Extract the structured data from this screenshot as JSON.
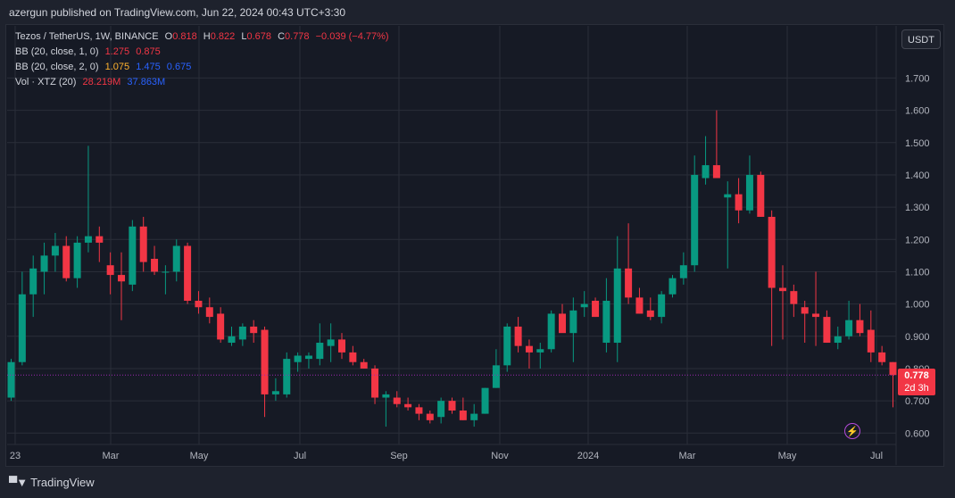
{
  "header": {
    "publisher_line": "azergun published on TradingView.com, Jun 22, 2024 00:43 UTC+3:30"
  },
  "legend": {
    "symbol": "Tezos / TetherUS, 1W, BINANCE",
    "o_label": "O",
    "o": "0.818",
    "h_label": "H",
    "h": "0.822",
    "l_label": "L",
    "l": "0.678",
    "c_label": "C",
    "c": "0.778",
    "change": "−0.039 (−4.77%)",
    "bb1_label": "BB (20, close, 1, 0)",
    "bb1_v1": "1.275",
    "bb1_v2": "0.875",
    "bb2_label": "BB (20, close, 2, 0)",
    "bb2_v1": "1.075",
    "bb2_v2": "1.475",
    "bb2_v3": "0.675",
    "vol_label": "Vol · XTZ (20)",
    "vol_v1": "28.219M",
    "vol_v2": "37.863M"
  },
  "unit_button": "USDT",
  "last_price": {
    "value": "0.778",
    "countdown": "2d 3h"
  },
  "footer": {
    "brand": "TradingView"
  },
  "colors": {
    "up": "#089981",
    "down": "#f23645",
    "background": "#161a25",
    "grid": "#2a2e39",
    "last_price_line": "#9c27b0"
  },
  "chart_data": {
    "type": "candlestick",
    "y_ticks": [
      "0.600",
      "0.700",
      "0.800",
      "0.900",
      "1.000",
      "1.100",
      "1.200",
      "1.300",
      "1.400",
      "1.500",
      "1.600",
      "1.700"
    ],
    "x_ticks": [
      "23",
      "Mar",
      "May",
      "Jul",
      "Sep",
      "Nov",
      "2024",
      "Mar",
      "May",
      "Jul"
    ],
    "ylim": [
      0.56,
      1.81
    ],
    "candles": [
      {
        "o": 0.71,
        "h": 0.83,
        "l": 0.7,
        "c": 0.82
      },
      {
        "o": 0.82,
        "h": 1.1,
        "l": 0.81,
        "c": 1.03
      },
      {
        "o": 1.03,
        "h": 1.15,
        "l": 0.96,
        "c": 1.11
      },
      {
        "o": 1.1,
        "h": 1.19,
        "l": 1.03,
        "c": 1.15
      },
      {
        "o": 1.15,
        "h": 1.22,
        "l": 1.1,
        "c": 1.18
      },
      {
        "o": 1.18,
        "h": 1.21,
        "l": 1.07,
        "c": 1.08
      },
      {
        "o": 1.08,
        "h": 1.21,
        "l": 1.05,
        "c": 1.19
      },
      {
        "o": 1.19,
        "h": 1.49,
        "l": 1.16,
        "c": 1.21
      },
      {
        "o": 1.21,
        "h": 1.24,
        "l": 1.13,
        "c": 1.19
      },
      {
        "o": 1.12,
        "h": 1.16,
        "l": 1.03,
        "c": 1.09
      },
      {
        "o": 1.09,
        "h": 1.16,
        "l": 0.95,
        "c": 1.07
      },
      {
        "o": 1.06,
        "h": 1.26,
        "l": 1.04,
        "c": 1.24
      },
      {
        "o": 1.24,
        "h": 1.27,
        "l": 1.1,
        "c": 1.13
      },
      {
        "o": 1.14,
        "h": 1.18,
        "l": 1.09,
        "c": 1.1
      },
      {
        "o": 1.1,
        "h": 1.12,
        "l": 1.03,
        "c": 1.1
      },
      {
        "o": 1.1,
        "h": 1.2,
        "l": 1.07,
        "c": 1.18
      },
      {
        "o": 1.18,
        "h": 1.19,
        "l": 1.0,
        "c": 1.01
      },
      {
        "o": 1.01,
        "h": 1.04,
        "l": 0.97,
        "c": 0.99
      },
      {
        "o": 0.99,
        "h": 1.02,
        "l": 0.94,
        "c": 0.96
      },
      {
        "o": 0.97,
        "h": 0.99,
        "l": 0.88,
        "c": 0.89
      },
      {
        "o": 0.88,
        "h": 0.93,
        "l": 0.87,
        "c": 0.9
      },
      {
        "o": 0.89,
        "h": 0.94,
        "l": 0.87,
        "c": 0.93
      },
      {
        "o": 0.93,
        "h": 0.95,
        "l": 0.88,
        "c": 0.91
      },
      {
        "o": 0.92,
        "h": 0.93,
        "l": 0.65,
        "c": 0.72
      },
      {
        "o": 0.72,
        "h": 0.77,
        "l": 0.7,
        "c": 0.73
      },
      {
        "o": 0.72,
        "h": 0.85,
        "l": 0.71,
        "c": 0.83
      },
      {
        "o": 0.82,
        "h": 0.85,
        "l": 0.79,
        "c": 0.84
      },
      {
        "o": 0.83,
        "h": 0.85,
        "l": 0.8,
        "c": 0.84
      },
      {
        "o": 0.83,
        "h": 0.94,
        "l": 0.81,
        "c": 0.88
      },
      {
        "o": 0.87,
        "h": 0.94,
        "l": 0.82,
        "c": 0.89
      },
      {
        "o": 0.89,
        "h": 0.91,
        "l": 0.83,
        "c": 0.85
      },
      {
        "o": 0.85,
        "h": 0.87,
        "l": 0.81,
        "c": 0.82
      },
      {
        "o": 0.82,
        "h": 0.83,
        "l": 0.8,
        "c": 0.8
      },
      {
        "o": 0.8,
        "h": 0.81,
        "l": 0.69,
        "c": 0.71
      },
      {
        "o": 0.71,
        "h": 0.73,
        "l": 0.62,
        "c": 0.72
      },
      {
        "o": 0.71,
        "h": 0.73,
        "l": 0.68,
        "c": 0.69
      },
      {
        "o": 0.69,
        "h": 0.71,
        "l": 0.67,
        "c": 0.68
      },
      {
        "o": 0.68,
        "h": 0.69,
        "l": 0.64,
        "c": 0.66
      },
      {
        "o": 0.66,
        "h": 0.67,
        "l": 0.63,
        "c": 0.64
      },
      {
        "o": 0.65,
        "h": 0.71,
        "l": 0.63,
        "c": 0.7
      },
      {
        "o": 0.7,
        "h": 0.71,
        "l": 0.66,
        "c": 0.67
      },
      {
        "o": 0.67,
        "h": 0.71,
        "l": 0.64,
        "c": 0.64
      },
      {
        "o": 0.64,
        "h": 0.69,
        "l": 0.62,
        "c": 0.66
      },
      {
        "o": 0.66,
        "h": 0.74,
        "l": 0.66,
        "c": 0.74
      },
      {
        "o": 0.74,
        "h": 0.86,
        "l": 0.74,
        "c": 0.81
      },
      {
        "o": 0.81,
        "h": 0.94,
        "l": 0.79,
        "c": 0.93
      },
      {
        "o": 0.93,
        "h": 0.96,
        "l": 0.85,
        "c": 0.87
      },
      {
        "o": 0.87,
        "h": 0.89,
        "l": 0.8,
        "c": 0.85
      },
      {
        "o": 0.85,
        "h": 0.88,
        "l": 0.8,
        "c": 0.86
      },
      {
        "o": 0.86,
        "h": 0.98,
        "l": 0.85,
        "c": 0.97
      },
      {
        "o": 0.97,
        "h": 1.0,
        "l": 0.92,
        "c": 0.91
      },
      {
        "o": 0.91,
        "h": 1.02,
        "l": 0.82,
        "c": 0.98
      },
      {
        "o": 0.99,
        "h": 1.04,
        "l": 0.96,
        "c": 1.0
      },
      {
        "o": 1.01,
        "h": 1.02,
        "l": 0.96,
        "c": 0.96
      },
      {
        "o": 0.88,
        "h": 1.08,
        "l": 0.85,
        "c": 1.01
      },
      {
        "o": 0.88,
        "h": 1.21,
        "l": 0.82,
        "c": 1.11
      },
      {
        "o": 1.11,
        "h": 1.25,
        "l": 1.0,
        "c": 1.02
      },
      {
        "o": 1.02,
        "h": 1.05,
        "l": 0.97,
        "c": 0.97
      },
      {
        "o": 0.98,
        "h": 1.02,
        "l": 0.95,
        "c": 0.96
      },
      {
        "o": 0.96,
        "h": 1.04,
        "l": 0.94,
        "c": 1.03
      },
      {
        "o": 1.03,
        "h": 1.09,
        "l": 1.02,
        "c": 1.08
      },
      {
        "o": 1.08,
        "h": 1.16,
        "l": 1.06,
        "c": 1.12
      },
      {
        "o": 1.12,
        "h": 1.46,
        "l": 1.1,
        "c": 1.4
      },
      {
        "o": 1.39,
        "h": 1.52,
        "l": 1.37,
        "c": 1.43
      },
      {
        "o": 1.43,
        "h": 1.6,
        "l": 1.4,
        "c": 1.39
      },
      {
        "o": 1.33,
        "h": 1.38,
        "l": 1.11,
        "c": 1.34
      },
      {
        "o": 1.34,
        "h": 1.39,
        "l": 1.25,
        "c": 1.29
      },
      {
        "o": 1.29,
        "h": 1.46,
        "l": 1.28,
        "c": 1.4
      },
      {
        "o": 1.4,
        "h": 1.41,
        "l": 1.27,
        "c": 1.27
      },
      {
        "o": 1.27,
        "h": 1.29,
        "l": 0.87,
        "c": 1.05
      },
      {
        "o": 1.05,
        "h": 1.12,
        "l": 0.89,
        "c": 1.04
      },
      {
        "o": 1.04,
        "h": 1.06,
        "l": 0.96,
        "c": 1.0
      },
      {
        "o": 0.99,
        "h": 1.01,
        "l": 0.88,
        "c": 0.97
      },
      {
        "o": 0.97,
        "h": 1.1,
        "l": 0.87,
        "c": 0.96
      },
      {
        "o": 0.96,
        "h": 0.98,
        "l": 0.88,
        "c": 0.88
      },
      {
        "o": 0.88,
        "h": 0.93,
        "l": 0.86,
        "c": 0.9
      },
      {
        "o": 0.9,
        "h": 1.01,
        "l": 0.89,
        "c": 0.95
      },
      {
        "o": 0.95,
        "h": 1.0,
        "l": 0.9,
        "c": 0.91
      },
      {
        "o": 0.92,
        "h": 0.98,
        "l": 0.82,
        "c": 0.85
      },
      {
        "o": 0.85,
        "h": 0.87,
        "l": 0.81,
        "c": 0.82
      },
      {
        "o": 0.82,
        "h": 0.82,
        "l": 0.68,
        "c": 0.78
      }
    ]
  }
}
